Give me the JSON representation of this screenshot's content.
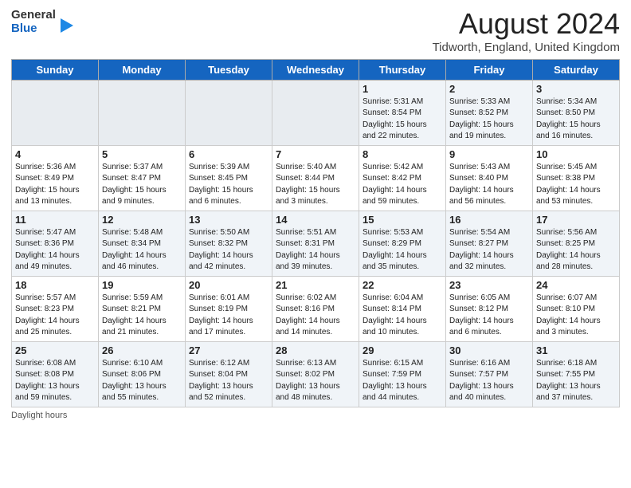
{
  "header": {
    "logo_line1": "General",
    "logo_line2": "Blue",
    "title": "August 2024",
    "subtitle": "Tidworth, England, United Kingdom"
  },
  "days_of_week": [
    "Sunday",
    "Monday",
    "Tuesday",
    "Wednesday",
    "Thursday",
    "Friday",
    "Saturday"
  ],
  "weeks": [
    [
      {
        "day": "",
        "info": ""
      },
      {
        "day": "",
        "info": ""
      },
      {
        "day": "",
        "info": ""
      },
      {
        "day": "",
        "info": ""
      },
      {
        "day": "1",
        "info": "Sunrise: 5:31 AM\nSunset: 8:54 PM\nDaylight: 15 hours\nand 22 minutes."
      },
      {
        "day": "2",
        "info": "Sunrise: 5:33 AM\nSunset: 8:52 PM\nDaylight: 15 hours\nand 19 minutes."
      },
      {
        "day": "3",
        "info": "Sunrise: 5:34 AM\nSunset: 8:50 PM\nDaylight: 15 hours\nand 16 minutes."
      }
    ],
    [
      {
        "day": "4",
        "info": "Sunrise: 5:36 AM\nSunset: 8:49 PM\nDaylight: 15 hours\nand 13 minutes."
      },
      {
        "day": "5",
        "info": "Sunrise: 5:37 AM\nSunset: 8:47 PM\nDaylight: 15 hours\nand 9 minutes."
      },
      {
        "day": "6",
        "info": "Sunrise: 5:39 AM\nSunset: 8:45 PM\nDaylight: 15 hours\nand 6 minutes."
      },
      {
        "day": "7",
        "info": "Sunrise: 5:40 AM\nSunset: 8:44 PM\nDaylight: 15 hours\nand 3 minutes."
      },
      {
        "day": "8",
        "info": "Sunrise: 5:42 AM\nSunset: 8:42 PM\nDaylight: 14 hours\nand 59 minutes."
      },
      {
        "day": "9",
        "info": "Sunrise: 5:43 AM\nSunset: 8:40 PM\nDaylight: 14 hours\nand 56 minutes."
      },
      {
        "day": "10",
        "info": "Sunrise: 5:45 AM\nSunset: 8:38 PM\nDaylight: 14 hours\nand 53 minutes."
      }
    ],
    [
      {
        "day": "11",
        "info": "Sunrise: 5:47 AM\nSunset: 8:36 PM\nDaylight: 14 hours\nand 49 minutes."
      },
      {
        "day": "12",
        "info": "Sunrise: 5:48 AM\nSunset: 8:34 PM\nDaylight: 14 hours\nand 46 minutes."
      },
      {
        "day": "13",
        "info": "Sunrise: 5:50 AM\nSunset: 8:32 PM\nDaylight: 14 hours\nand 42 minutes."
      },
      {
        "day": "14",
        "info": "Sunrise: 5:51 AM\nSunset: 8:31 PM\nDaylight: 14 hours\nand 39 minutes."
      },
      {
        "day": "15",
        "info": "Sunrise: 5:53 AM\nSunset: 8:29 PM\nDaylight: 14 hours\nand 35 minutes."
      },
      {
        "day": "16",
        "info": "Sunrise: 5:54 AM\nSunset: 8:27 PM\nDaylight: 14 hours\nand 32 minutes."
      },
      {
        "day": "17",
        "info": "Sunrise: 5:56 AM\nSunset: 8:25 PM\nDaylight: 14 hours\nand 28 minutes."
      }
    ],
    [
      {
        "day": "18",
        "info": "Sunrise: 5:57 AM\nSunset: 8:23 PM\nDaylight: 14 hours\nand 25 minutes."
      },
      {
        "day": "19",
        "info": "Sunrise: 5:59 AM\nSunset: 8:21 PM\nDaylight: 14 hours\nand 21 minutes."
      },
      {
        "day": "20",
        "info": "Sunrise: 6:01 AM\nSunset: 8:19 PM\nDaylight: 14 hours\nand 17 minutes."
      },
      {
        "day": "21",
        "info": "Sunrise: 6:02 AM\nSunset: 8:16 PM\nDaylight: 14 hours\nand 14 minutes."
      },
      {
        "day": "22",
        "info": "Sunrise: 6:04 AM\nSunset: 8:14 PM\nDaylight: 14 hours\nand 10 minutes."
      },
      {
        "day": "23",
        "info": "Sunrise: 6:05 AM\nSunset: 8:12 PM\nDaylight: 14 hours\nand 6 minutes."
      },
      {
        "day": "24",
        "info": "Sunrise: 6:07 AM\nSunset: 8:10 PM\nDaylight: 14 hours\nand 3 minutes."
      }
    ],
    [
      {
        "day": "25",
        "info": "Sunrise: 6:08 AM\nSunset: 8:08 PM\nDaylight: 13 hours\nand 59 minutes."
      },
      {
        "day": "26",
        "info": "Sunrise: 6:10 AM\nSunset: 8:06 PM\nDaylight: 13 hours\nand 55 minutes."
      },
      {
        "day": "27",
        "info": "Sunrise: 6:12 AM\nSunset: 8:04 PM\nDaylight: 13 hours\nand 52 minutes."
      },
      {
        "day": "28",
        "info": "Sunrise: 6:13 AM\nSunset: 8:02 PM\nDaylight: 13 hours\nand 48 minutes."
      },
      {
        "day": "29",
        "info": "Sunrise: 6:15 AM\nSunset: 7:59 PM\nDaylight: 13 hours\nand 44 minutes."
      },
      {
        "day": "30",
        "info": "Sunrise: 6:16 AM\nSunset: 7:57 PM\nDaylight: 13 hours\nand 40 minutes."
      },
      {
        "day": "31",
        "info": "Sunrise: 6:18 AM\nSunset: 7:55 PM\nDaylight: 13 hours\nand 37 minutes."
      }
    ]
  ],
  "footer": {
    "daylight_label": "Daylight hours"
  }
}
